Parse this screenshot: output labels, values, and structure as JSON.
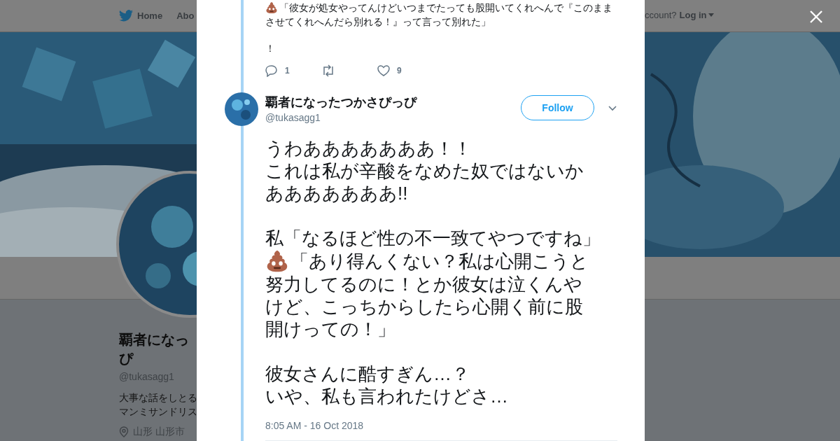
{
  "background_page": {
    "nav": {
      "items": [
        "Home",
        "Abo"
      ],
      "account_prompt": "ccount?",
      "login": "Log in"
    },
    "profile": {
      "name_lines": [
        "覇者になっ",
        "ぴ"
      ],
      "handle": "@tukasagg1",
      "bio_lines": [
        "大事な話をしとる",
        "マンミサンドリス"
      ],
      "location": "山形 山形市"
    }
  },
  "modal": {
    "previous_tweet": {
      "blocks": [
        {
          "lines": [
            {
              "kind": "emoji_text",
              "text": "「彼女が処女やってんけどいつまでたっても股開いてくれへんで『このまま"
            },
            {
              "kind": "text",
              "text": "させてくれへんだら別れる！』って言って別れた」"
            }
          ]
        },
        {
          "lines": [
            {
              "kind": "text",
              "text": "！"
            }
          ]
        }
      ],
      "actions": [
        {
          "kind": "reply",
          "count": "1"
        },
        {
          "kind": "retweet"
        },
        {
          "kind": "like",
          "count": "9"
        }
      ]
    },
    "tweet": {
      "name": "覇者になったつかさぴっぴ",
      "handle": "@tukasagg1",
      "follow": "Follow",
      "blocks": [
        {
          "lines": [
            {
              "kind": "text",
              "text": "うわあああああああ！！"
            },
            {
              "kind": "text",
              "text": "これは私が辛酸をなめた奴ではないか"
            },
            {
              "kind": "text",
              "text": "あああああああ!!"
            }
          ]
        },
        {
          "lines": [
            {
              "kind": "text",
              "text": "私「なるほど性の不一致てやつですね」"
            },
            {
              "kind": "emoji_text",
              "text": "「あり得んくない？私は心開こうと"
            },
            {
              "kind": "text",
              "text": "努力してるのに！とか彼女は泣くんや"
            },
            {
              "kind": "text",
              "text": "けど、こっちからしたら心開く前に股"
            },
            {
              "kind": "text",
              "text": "開けっての！」"
            }
          ]
        },
        {
          "lines": [
            {
              "kind": "text",
              "text": "彼女さんに酷すぎん…？"
            },
            {
              "kind": "text",
              "text": "いや、私も言われたけどさ…"
            }
          ]
        }
      ],
      "timestamp": "8:05 AM - 16 Oct 2018"
    }
  }
}
